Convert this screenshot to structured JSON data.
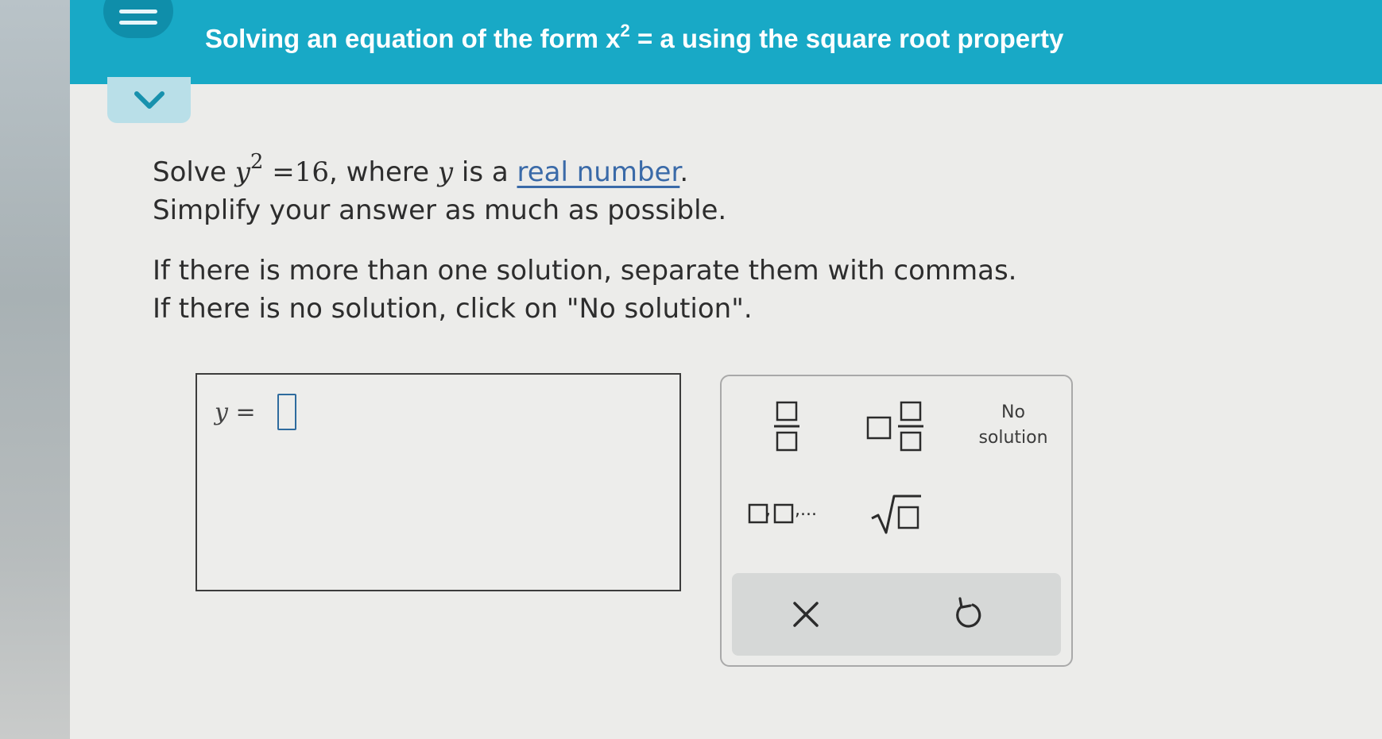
{
  "header": {
    "title_prefix": "Solving an equation of the form x",
    "title_exp": "2",
    "title_suffix": " = a using the square root property"
  },
  "question": {
    "solve_word": "Solve ",
    "variable": "y",
    "exponent": "2",
    "equals": " =16",
    "where": ", where ",
    "is_a": " is a ",
    "link_text": "real number",
    "period": ".",
    "line2": "Simplify your answer as much as possible.",
    "line3": "If there is more than one solution, separate them with commas.",
    "line4": "If there is no solution, click on \"No solution\"."
  },
  "answer": {
    "variable": "y",
    "equals": " ="
  },
  "keypad": {
    "no_solution_line1": "No",
    "no_solution_line2": "solution",
    "list_ellipsis": ",...",
    "list_comma": ","
  },
  "icons": {
    "menu": "hamburger-icon",
    "collapse": "chevron-down-icon",
    "fraction": "fraction-icon",
    "mixed_number": "mixed-number-icon",
    "list": "list-icon",
    "sqrt": "square-root-icon",
    "clear": "close-icon",
    "undo": "undo-icon"
  },
  "colors": {
    "header": "#18a9c6",
    "accent": "#2e6b9e",
    "link": "#3a6aa8"
  }
}
